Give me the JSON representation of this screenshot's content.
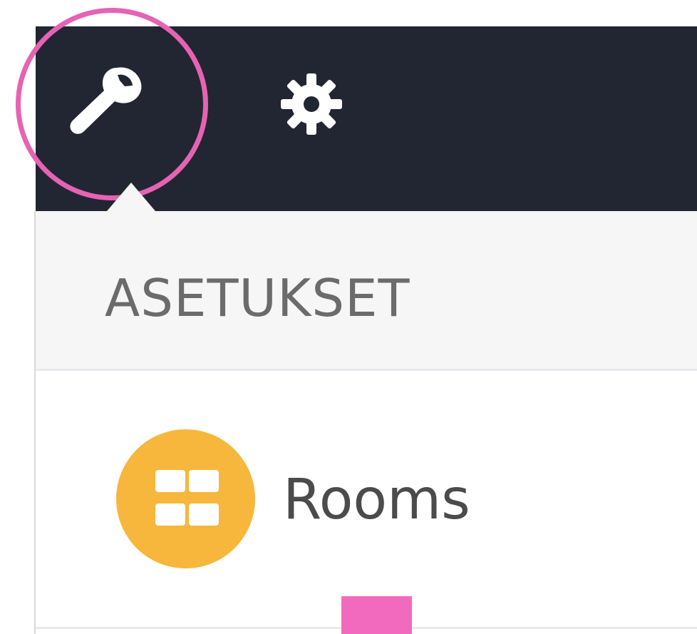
{
  "toolbar": {
    "wrench_icon": "wrench-icon",
    "settings_icon": "gear-icon",
    "background_color": "#222632",
    "highlight_color": "#e563b2"
  },
  "settings_panel": {
    "section_title": "ASETUKSET",
    "items": [
      {
        "label": "Rooms",
        "icon": "rooms-grid-icon",
        "icon_color": "#f6b73c"
      }
    ]
  },
  "marker": {
    "color": "#f26abd"
  }
}
